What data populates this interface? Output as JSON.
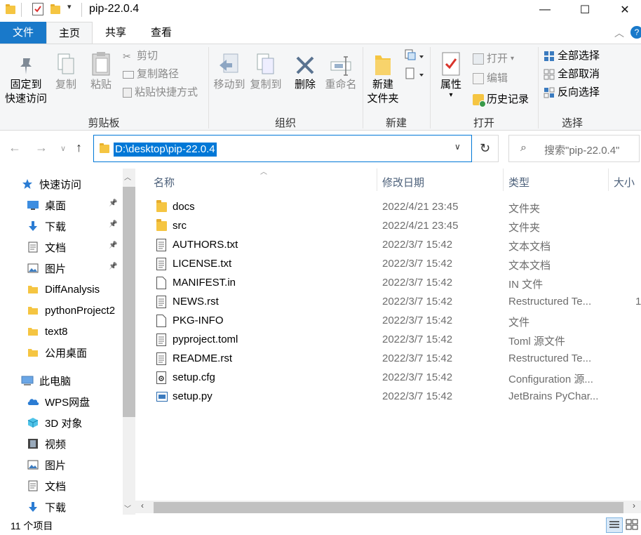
{
  "window": {
    "title": "pip-22.0.4",
    "minimize": "—",
    "maximize": "☐",
    "close": "✕"
  },
  "ribbon_tabs": [
    "文件",
    "主页",
    "共享",
    "查看"
  ],
  "ribbon": {
    "clipboard": {
      "pin_quick_access": [
        "固定到",
        "快速访问"
      ],
      "copy": "复制",
      "paste": "粘贴",
      "cut": "剪切",
      "copy_path": "复制路径",
      "paste_shortcut": "粘贴快捷方式",
      "label": "剪贴板"
    },
    "organize": {
      "move_to": "移动到",
      "copy_to": "复制到",
      "delete": "删除",
      "rename": "重命名",
      "label": "组织"
    },
    "new": {
      "new_folder": [
        "新建",
        "文件夹"
      ],
      "label": "新建"
    },
    "open": {
      "properties": "属性",
      "open": "打开",
      "edit": "编辑",
      "history": "历史记录",
      "label": "打开"
    },
    "select": {
      "select_all": "全部选择",
      "select_none": "全部取消",
      "invert": "反向选择",
      "label": "选择"
    }
  },
  "address": {
    "path": "D:\\desktop\\pip-22.0.4",
    "search_placeholder": "搜索\"pip-22.0.4\""
  },
  "nav_pane": {
    "items": [
      {
        "label": "快速访问",
        "icon": "star-icon",
        "pinned": false
      },
      {
        "label": "桌面",
        "icon": "desktop-icon",
        "pinned": true
      },
      {
        "label": "下载",
        "icon": "download-icon",
        "pinned": true
      },
      {
        "label": "文档",
        "icon": "document-icon",
        "pinned": true
      },
      {
        "label": "图片",
        "icon": "picture-icon",
        "pinned": true
      },
      {
        "label": "DiffAnalysis",
        "icon": "folder-icon",
        "pinned": false
      },
      {
        "label": "pythonProject2",
        "icon": "folder-icon",
        "pinned": false
      },
      {
        "label": "text8",
        "icon": "folder-icon",
        "pinned": false
      },
      {
        "label": "公用桌面",
        "icon": "folder-icon",
        "pinned": false
      },
      {
        "label": "此电脑",
        "icon": "computer-icon",
        "pinned": false
      },
      {
        "label": "WPS网盘",
        "icon": "cloud-icon",
        "pinned": false
      },
      {
        "label": "3D 对象",
        "icon": "cube-icon",
        "pinned": false
      },
      {
        "label": "视频",
        "icon": "video-icon",
        "pinned": false
      },
      {
        "label": "图片",
        "icon": "picture-icon",
        "pinned": false
      },
      {
        "label": "文档",
        "icon": "document-icon",
        "pinned": false
      },
      {
        "label": "下载",
        "icon": "download-icon",
        "pinned": false
      }
    ]
  },
  "columns": {
    "name": "名称",
    "date": "修改日期",
    "type": "类型",
    "size": "大小"
  },
  "files": [
    {
      "name": "docs",
      "date": "2022/4/21 23:45",
      "type": "文件夹",
      "size": "",
      "kind": "folder"
    },
    {
      "name": "src",
      "date": "2022/4/21 23:45",
      "type": "文件夹",
      "size": "",
      "kind": "folder"
    },
    {
      "name": "AUTHORS.txt",
      "date": "2022/3/7 15:42",
      "type": "文本文档",
      "size": "",
      "kind": "doc"
    },
    {
      "name": "LICENSE.txt",
      "date": "2022/3/7 15:42",
      "type": "文本文档",
      "size": "",
      "kind": "doc"
    },
    {
      "name": "MANIFEST.in",
      "date": "2022/3/7 15:42",
      "type": "IN 文件",
      "size": "",
      "kind": "blank"
    },
    {
      "name": "NEWS.rst",
      "date": "2022/3/7 15:42",
      "type": "Restructured Te...",
      "size": "1",
      "kind": "doc"
    },
    {
      "name": "PKG-INFO",
      "date": "2022/3/7 15:42",
      "type": "文件",
      "size": "",
      "kind": "blank"
    },
    {
      "name": "pyproject.toml",
      "date": "2022/3/7 15:42",
      "type": "Toml 源文件",
      "size": "",
      "kind": "doc"
    },
    {
      "name": "README.rst",
      "date": "2022/3/7 15:42",
      "type": "Restructured Te...",
      "size": "",
      "kind": "doc"
    },
    {
      "name": "setup.cfg",
      "date": "2022/3/7 15:42",
      "type": "Configuration 源...",
      "size": "",
      "kind": "cfg"
    },
    {
      "name": "setup.py",
      "date": "2022/3/7 15:42",
      "type": "JetBrains PyChar...",
      "size": "",
      "kind": "py"
    }
  ],
  "status": {
    "item_count": "11 个项目"
  },
  "colors": {
    "accent": "#0078d7",
    "file_tab": "#1979ca",
    "folder": "#f5c542"
  }
}
